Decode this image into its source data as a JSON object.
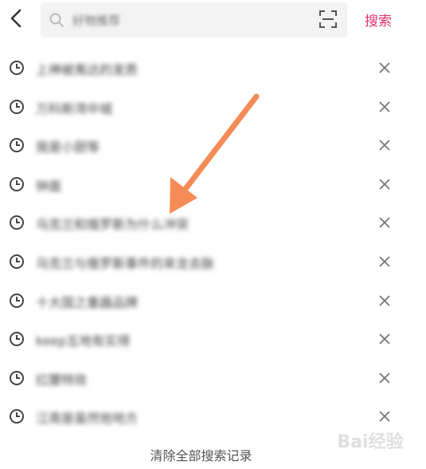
{
  "search": {
    "placeholder": "好物推荐",
    "button_label": "搜索"
  },
  "history": [
    {
      "term": "上神被夷达的发质"
    },
    {
      "term": "万科新湾中城"
    },
    {
      "term": "我是小厨等"
    },
    {
      "term": "钟面"
    },
    {
      "term": "乌克兰和俄罗斯为什么冲突"
    },
    {
      "term": "乌克兰与俄罗斯事件的来龙去脉"
    },
    {
      "term": "十大国之重器品牌"
    },
    {
      "term": "keep五地有实得"
    },
    {
      "term": "红腰特效"
    },
    {
      "term": "江南是虽然他地方"
    }
  ],
  "footer": {
    "clear_label": "清除全部搜索记录"
  },
  "watermark": {
    "text": "Bai经验"
  },
  "colors": {
    "accent": "#e0336a",
    "arrow": "#f58b56"
  }
}
